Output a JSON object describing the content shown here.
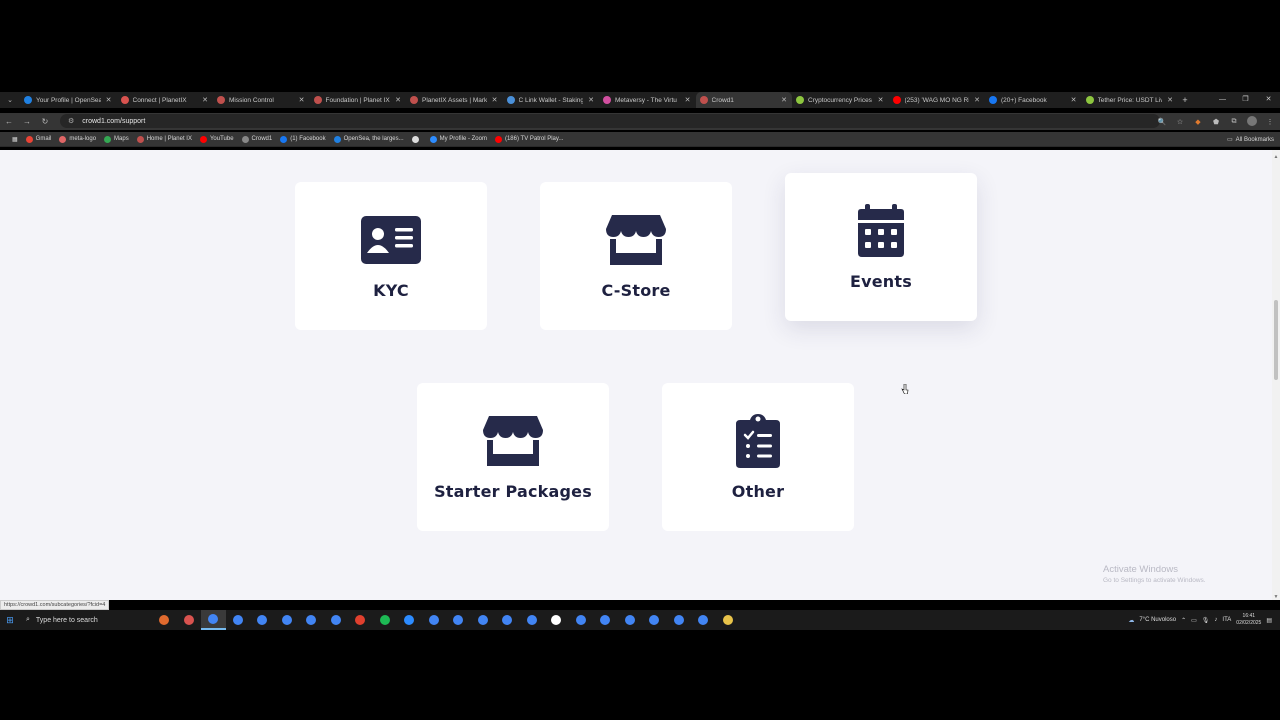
{
  "browser": {
    "tabs": [
      {
        "title": "Your Profile | OpenSea",
        "color": "#2081e2",
        "active": false
      },
      {
        "title": "Connect | PlanetIX",
        "color": "#d9534f",
        "active": false
      },
      {
        "title": "Mission Control",
        "color": "#c0504d",
        "active": false
      },
      {
        "title": "Foundation | Planet IX",
        "color": "#c0504d",
        "active": false
      },
      {
        "title": "PlanetIX Assets | Mark",
        "color": "#c0504d",
        "active": false
      },
      {
        "title": "C Link Wallet - Staking",
        "color": "#4a90d9",
        "active": false
      },
      {
        "title": "Metaversy - The Virtu",
        "color": "#d24fa0",
        "active": false
      },
      {
        "title": "Crowd1",
        "color": "#c0504d",
        "active": true
      },
      {
        "title": "Cryptocurrency Prices",
        "color": "#8dc63f",
        "active": false
      },
      {
        "title": "(253) 'WAG MO NG Ri",
        "color": "#ff0000",
        "active": false
      },
      {
        "title": "(20+) Facebook",
        "color": "#1877f2",
        "active": false
      },
      {
        "title": "Tether Price: USDT Liv",
        "color": "#8dc63f",
        "active": false
      }
    ],
    "url": "crowd1.com/support",
    "bookmarks": [
      {
        "label": "Gmail",
        "color": "#ea4335"
      },
      {
        "label": "meta-logo",
        "color": "#e06666"
      },
      {
        "label": "Maps",
        "color": "#34a853"
      },
      {
        "label": "Home | Planet IX",
        "color": "#c0504d"
      },
      {
        "label": "YouTube",
        "color": "#ff0000"
      },
      {
        "label": "Crowd1",
        "color": "#888888"
      },
      {
        "label": "(1) Facebook",
        "color": "#1877f2"
      },
      {
        "label": "OpenSea, the larges...",
        "color": "#2081e2"
      },
      {
        "label": "",
        "color": "#dddddd"
      },
      {
        "label": "My Profile - Zoom",
        "color": "#2d8cff"
      },
      {
        "label": "(186) TV Patrol Play...",
        "color": "#ff0000"
      }
    ],
    "all_bookmarks": "All Bookmarks",
    "status_url": "https://crowd1.com/subcategories/?fcid=4"
  },
  "support": {
    "cards": [
      {
        "label": "KYC",
        "icon": "id-card-icon"
      },
      {
        "label": "C-Store",
        "icon": "store-icon"
      },
      {
        "label": "Events",
        "icon": "calendar-icon"
      },
      {
        "label": "Starter Packages",
        "icon": "store-icon"
      },
      {
        "label": "Other",
        "icon": "clipboard-check-icon"
      }
    ],
    "icon_color": "#262a4a"
  },
  "watermark": {
    "title": "Activate Windows",
    "subtitle": "Go to Settings to activate Windows."
  },
  "taskbar": {
    "search_placeholder": "Type here to search",
    "weather": "7°C  Nuvoloso",
    "lang": "ITA",
    "time": "16:41",
    "date": "02/02/2025"
  }
}
